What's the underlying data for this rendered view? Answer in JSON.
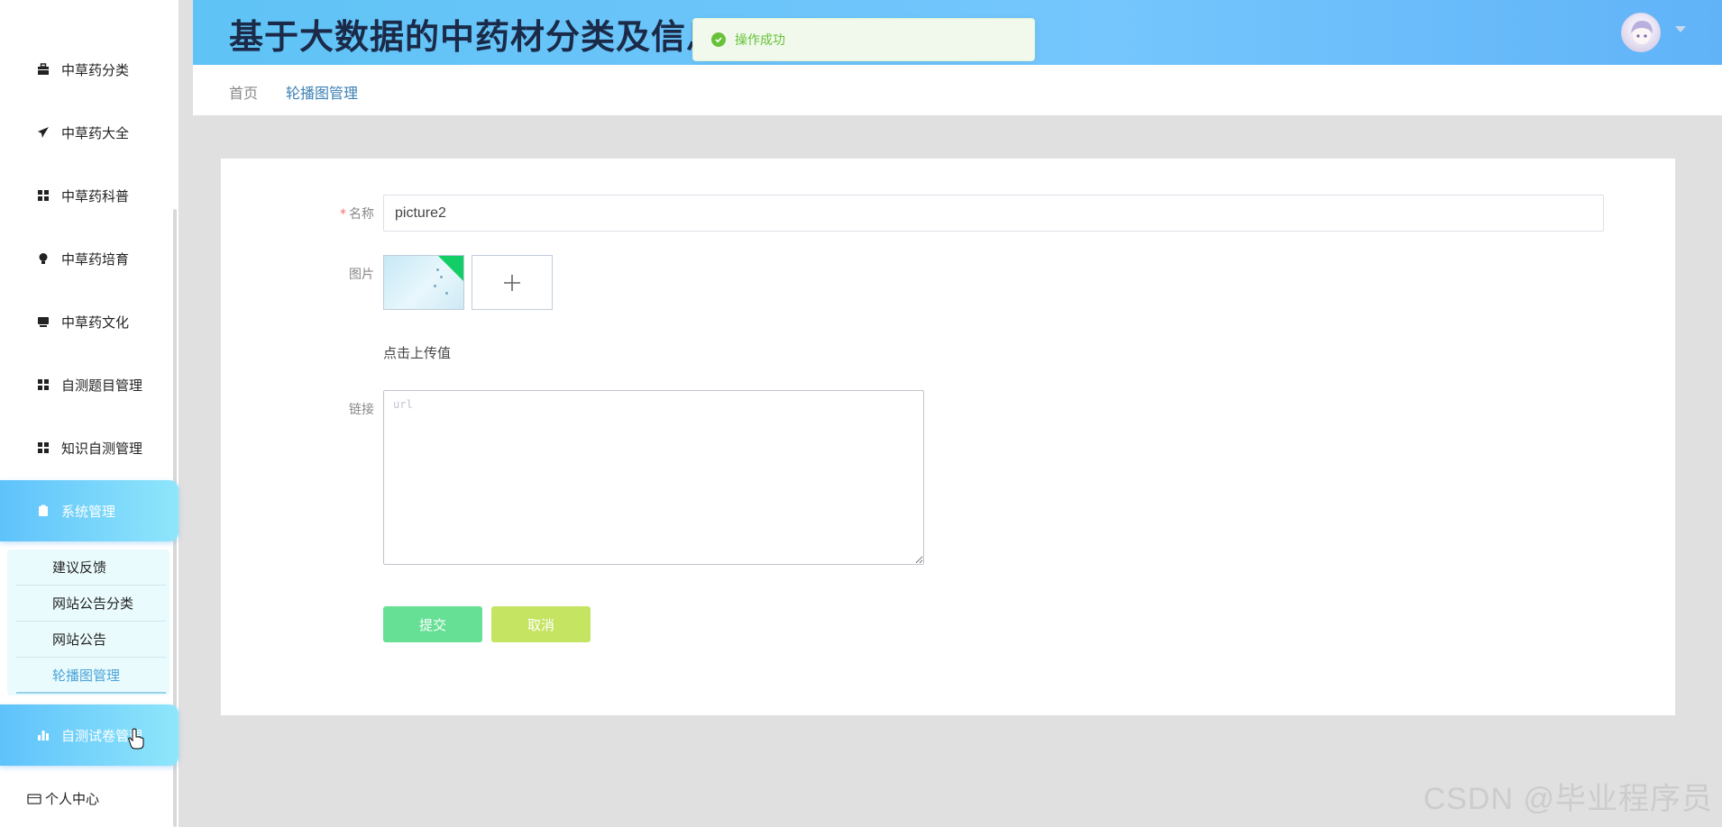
{
  "header": {
    "title": "基于大数据的中药材分类及信息管理"
  },
  "toast": {
    "message": "操作成功"
  },
  "sidebar": {
    "items": [
      {
        "label": "中草药分类",
        "icon": "briefcase-icon"
      },
      {
        "label": "中草药大全",
        "icon": "paper-plane-icon"
      },
      {
        "label": "中草药科普",
        "icon": "grid-icon"
      },
      {
        "label": "中草药培育",
        "icon": "lightbulb-icon"
      },
      {
        "label": "中草药文化",
        "icon": "monitor-icon"
      },
      {
        "label": "自测题目管理",
        "icon": "grid-icon"
      },
      {
        "label": "知识自测管理",
        "icon": "grid-icon"
      },
      {
        "label": "系统管理",
        "icon": "clipboard-icon"
      },
      {
        "label": "自测试卷管理",
        "icon": "bar-chart-icon"
      }
    ],
    "submenu": [
      {
        "label": "建议反馈"
      },
      {
        "label": "网站公告分类"
      },
      {
        "label": "网站公告"
      },
      {
        "label": "轮播图管理"
      }
    ],
    "personal": "个人中心"
  },
  "breadcrumb": {
    "home": "首页",
    "current": "轮播图管理"
  },
  "form": {
    "name_label": "名称",
    "name_value": "picture2",
    "image_label": "图片",
    "upload_hint": "点击上传值",
    "link_label": "链接",
    "link_placeholder": "url",
    "submit_label": "提交",
    "cancel_label": "取消"
  },
  "watermark": "CSDN @毕业程序员",
  "colors": {
    "header_gradient_start": "#5fc3f5",
    "header_gradient_end": "#60b3f7",
    "active_menu": "#5ec2fb",
    "submit": "#66e095",
    "cancel": "#c5e462",
    "success": "#67c23a"
  }
}
